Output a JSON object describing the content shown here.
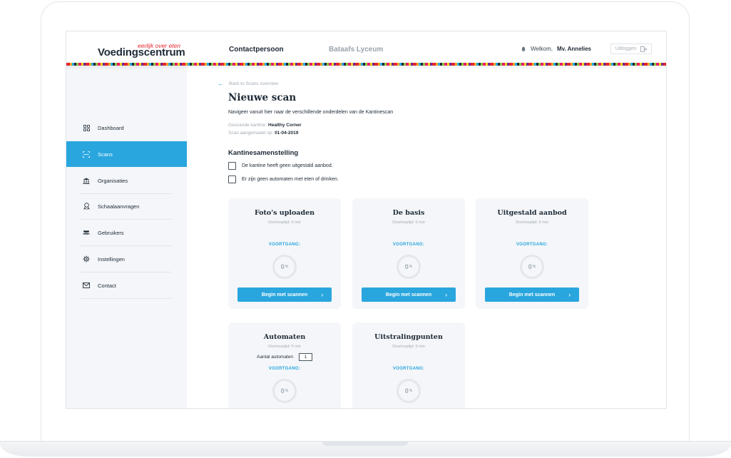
{
  "header": {
    "logo_tagline": "eerlijk over eten",
    "logo_name": "Voedingscentrum",
    "tab_active": "Contactpersoon",
    "tab_inactive": "Bataafs Lyceum",
    "welcome_prefix": "Welkom,",
    "welcome_user": "Mv. Annelies",
    "logout_label": "Uitloggen"
  },
  "sidebar": {
    "items": [
      {
        "label": "Dashboard",
        "icon": "grid-icon"
      },
      {
        "label": "Scans",
        "icon": "scan-icon",
        "active": true
      },
      {
        "label": "Organisaties",
        "icon": "building-icon"
      },
      {
        "label": "Schaalaanvragen",
        "icon": "award-icon"
      },
      {
        "label": "Gebruikers",
        "icon": "users-icon"
      },
      {
        "label": "Instellingen",
        "icon": "gear-icon"
      },
      {
        "label": "Contact",
        "icon": "mail-icon"
      }
    ]
  },
  "main": {
    "back_label": "Back to Scans overview",
    "title": "Nieuwe scan",
    "subtitle": "Navigeer vanuit hier naar de verschillende onderdelen van de Kantinescan",
    "canteen_label": "Gescande kantine:",
    "canteen_value": "Healthy Corner",
    "created_label": "Scan aangemaakt op:",
    "created_value": "01-04-2019",
    "section_title": "Kantinesamenstelling",
    "checkboxes": [
      "De kantine heeft geen uitgestald aanbod.",
      "Er zijn geen automaten met eten of drinken."
    ],
    "cards": [
      {
        "title": "Foto's uploaden",
        "time": "Doorlooptijd: 5 min",
        "progress_label": "VOORTGANG:",
        "progress": 0,
        "unit": "%",
        "button": "Begin met scannen"
      },
      {
        "title": "De basis",
        "time": "Doorlooptijd: 5 min",
        "progress_label": "VOORTGANG:",
        "progress": 0,
        "unit": "%",
        "button": "Begin met scannen"
      },
      {
        "title": "Uitgestald aanbod",
        "time": "Doorlooptijd: 5 min",
        "progress_label": "VOORTGANG:",
        "progress": 0,
        "unit": "%",
        "button": "Begin met scannen"
      },
      {
        "title": "Automaten",
        "time": "Doorlooptijd: 5 min",
        "auto_label": "Aantal automaten",
        "auto_value": "1",
        "progress_label": "VOORTGANG:",
        "progress": 0,
        "unit": "%"
      },
      {
        "title": "Uitstralingpunten",
        "time": "Doorlooptijd: 5 min",
        "progress_label": "VOORTGANG:",
        "progress": 0,
        "unit": "%"
      }
    ]
  },
  "colors": {
    "accent": "#29a6de",
    "brand_red": "#e3262f",
    "card_bg": "#f4f6f9"
  }
}
